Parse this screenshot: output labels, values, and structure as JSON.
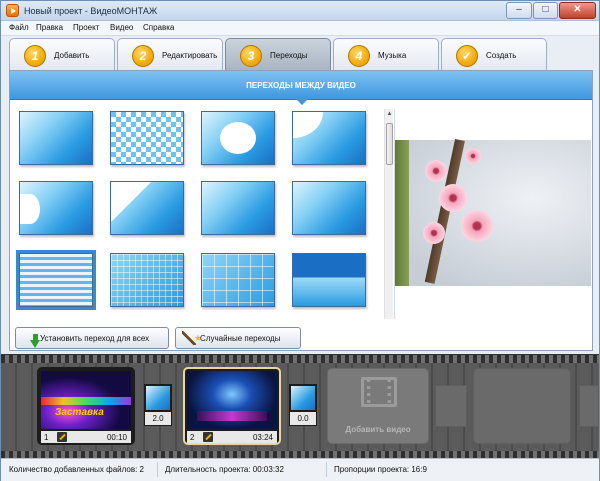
{
  "window": {
    "title": "Новый проект - ВидеоМОНТАЖ",
    "controls": {
      "minimize": "–",
      "maximize": "□",
      "close": "✕"
    }
  },
  "menu": {
    "items": [
      "Файл",
      "Правка",
      "Проект",
      "Видео",
      "Справка"
    ]
  },
  "tabs": [
    {
      "num": "1",
      "label": "Добавить",
      "active": false
    },
    {
      "num": "2",
      "label": "Редактировать",
      "active": false
    },
    {
      "num": "3",
      "label": "Переходы",
      "active": true
    },
    {
      "num": "4",
      "label": "Музыка",
      "active": false
    },
    {
      "num": "✓",
      "label": "Создать",
      "active": false
    }
  ],
  "section": {
    "title": "ПЕРЕХОДЫ МЕЖДУ ВИДЕО"
  },
  "transitions": {
    "selected_index": 8,
    "items": [
      {
        "name": "plain-blue"
      },
      {
        "name": "checker"
      },
      {
        "name": "circle-center"
      },
      {
        "name": "corner-top-left"
      },
      {
        "name": "left-half"
      },
      {
        "name": "diagonal-wipe"
      },
      {
        "name": "arrow-center"
      },
      {
        "name": "plain-blue-2"
      },
      {
        "name": "horizontal-lines"
      },
      {
        "name": "small-grid"
      },
      {
        "name": "large-grid"
      },
      {
        "name": "band-down"
      }
    ]
  },
  "actions": {
    "apply_all": "Установить переход для всех",
    "random": "Случайные переходы"
  },
  "timeline": {
    "clips": [
      {
        "num": "1",
        "duration": "00:10",
        "thumb_text": "Заставка",
        "selected": false
      },
      {
        "num": "2",
        "duration": "03:24",
        "selected": true
      }
    ],
    "transitions": [
      "2.0",
      "0.0"
    ],
    "add_video_label": "Добавить видео"
  },
  "status": {
    "files": "Количество добавленных файлов: 2",
    "duration": "Длительность проекта: 00:03:32",
    "ratio": "Пропорции проекта: 16:9"
  },
  "colors": {
    "accent": "#3f97de",
    "tab_badge": "#f0a400",
    "timeline_bg": "#5a5a5a"
  }
}
